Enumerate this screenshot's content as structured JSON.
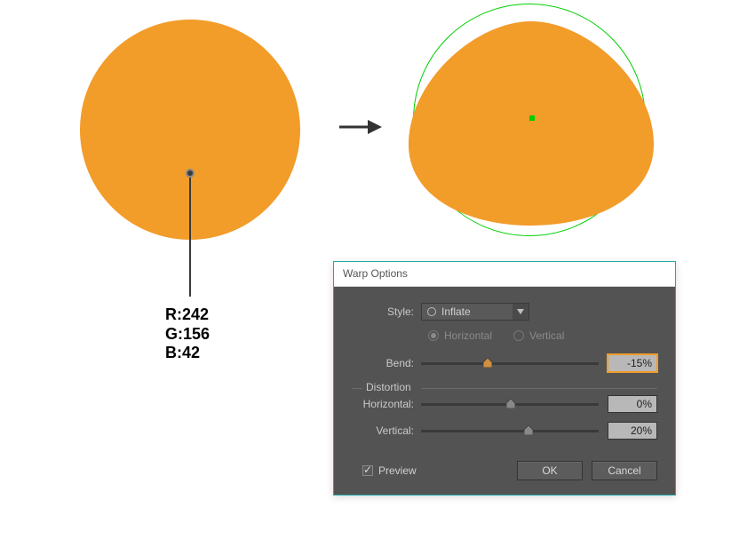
{
  "color_readout": {
    "r": "R:242",
    "g": "G:156",
    "b": "B:42"
  },
  "shape_color": "#f29c2a",
  "dialog": {
    "title": "Warp Options",
    "style_label": "Style:",
    "style_value": "Inflate",
    "orientation": {
      "horizontal": "Horizontal",
      "vertical": "Vertical"
    },
    "bend": {
      "label": "Bend:",
      "value": "-15%",
      "percent": 35
    },
    "distortion_label": "Distortion",
    "horizontal": {
      "label": "Horizontal:",
      "value": "0%",
      "percent": 50
    },
    "vertical": {
      "label": "Vertical:",
      "value": "20%",
      "percent": 60
    },
    "preview_label": "Preview",
    "ok_label": "OK",
    "cancel_label": "Cancel"
  }
}
